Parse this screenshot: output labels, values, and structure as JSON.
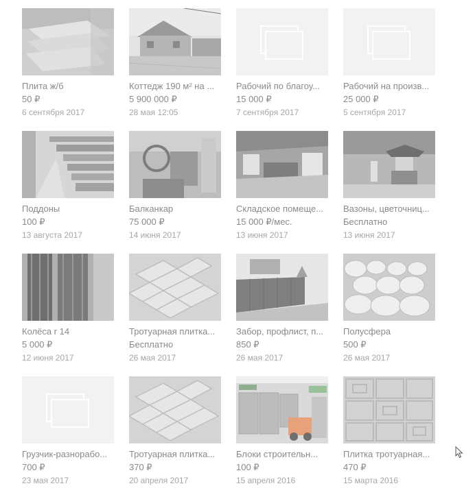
{
  "listings": [
    {
      "title": "Плита ж/б",
      "price": "50 ₽",
      "date": "6 сентября 2017",
      "image": "concrete-slab"
    },
    {
      "title": "Коттедж 190 м² на ...",
      "price": "5 900 000 ₽",
      "date": "28 мая 12:05",
      "image": "cottage"
    },
    {
      "title": "Рабочий по благоу...",
      "price": "15 000 ₽",
      "date": "7 сентября 2017",
      "image": "placeholder"
    },
    {
      "title": "Рабочий на произв...",
      "price": "25 000 ₽",
      "date": "5 сентября 2017",
      "image": "placeholder"
    },
    {
      "title": "Поддоны",
      "price": "100 ₽",
      "date": "13 августа 2017",
      "image": "pallets"
    },
    {
      "title": "Балканкар",
      "price": "75 000 ₽",
      "date": "14 июня 2017",
      "image": "forklift-cab"
    },
    {
      "title": "Складское помеще...",
      "price": "15 000 ₽/мес.",
      "date": "13 июня 2017",
      "image": "warehouse"
    },
    {
      "title": "Вазоны, цветочниц...",
      "price": "Бесплатно",
      "date": "13 июня 2017",
      "image": "garden-vases"
    },
    {
      "title": "Колёса r 14",
      "price": "5 000 ₽",
      "date": "12 июня 2017",
      "image": "tires"
    },
    {
      "title": "Тротуарная плитка...",
      "price": "Бесплатно",
      "date": "26 мая 2017",
      "image": "paving-tile"
    },
    {
      "title": "Забор, профлист, п...",
      "price": "850 ₽",
      "date": "26 мая 2017",
      "image": "fence"
    },
    {
      "title": "Полусфера",
      "price": "500 ₽",
      "date": "26 мая 2017",
      "image": "hemispheres"
    },
    {
      "title": "Грузчик-разнорабо...",
      "price": "700 ₽",
      "date": "23 мая 2017",
      "image": "placeholder"
    },
    {
      "title": "Тротуарная плитка...",
      "price": "370 ₽",
      "date": "20 апреля 2017",
      "image": "paving-tile"
    },
    {
      "title": "Блоки строительн...",
      "price": "100 ₽",
      "date": "15 апреля 2016",
      "image": "blocks-forklift"
    },
    {
      "title": "Плитка тротуарная...",
      "price": "470 ₽",
      "date": "15 марта 2016",
      "image": "tile-pattern"
    }
  ]
}
